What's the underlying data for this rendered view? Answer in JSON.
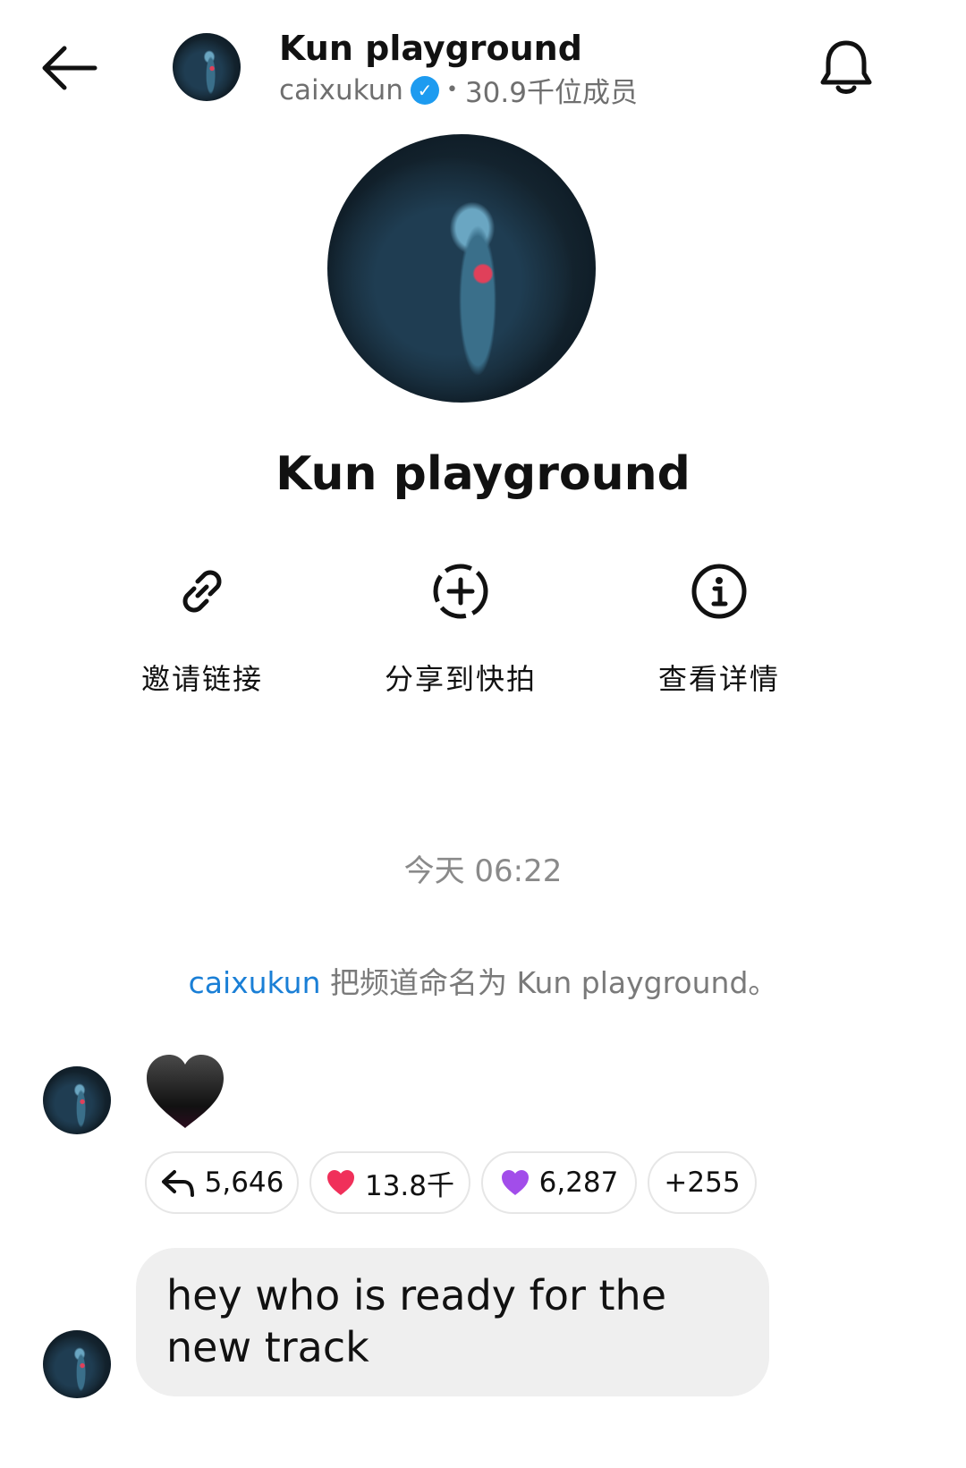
{
  "header": {
    "back_icon": "arrow-left-icon",
    "title": "Kun playground",
    "owner": "caixukun",
    "separator": "•",
    "members": "30.9千位成员",
    "bell_icon": "bell-icon"
  },
  "channel": {
    "name": "Kun playground"
  },
  "actions": [
    {
      "icon": "link-icon",
      "label": "邀请链接"
    },
    {
      "icon": "add-circle-icon",
      "label": "分享到快拍"
    },
    {
      "icon": "info-icon",
      "label": "查看详情"
    }
  ],
  "timestamp": "今天 06:22",
  "system_message": {
    "user": "caixukun",
    "text": " 把频道命名为 Kun playground。"
  },
  "messages": [
    {
      "type": "emoji",
      "content": "🖤",
      "reactions": [
        {
          "icon": "reply-icon",
          "count": "5,646"
        },
        {
          "icon": "red-heart",
          "emoji": "❤️",
          "count": "13.8千"
        },
        {
          "icon": "purple-heart",
          "emoji": "💜",
          "count": "6,287"
        },
        {
          "count": "+255"
        }
      ]
    },
    {
      "type": "text",
      "content": "hey who is ready for the new track"
    }
  ]
}
